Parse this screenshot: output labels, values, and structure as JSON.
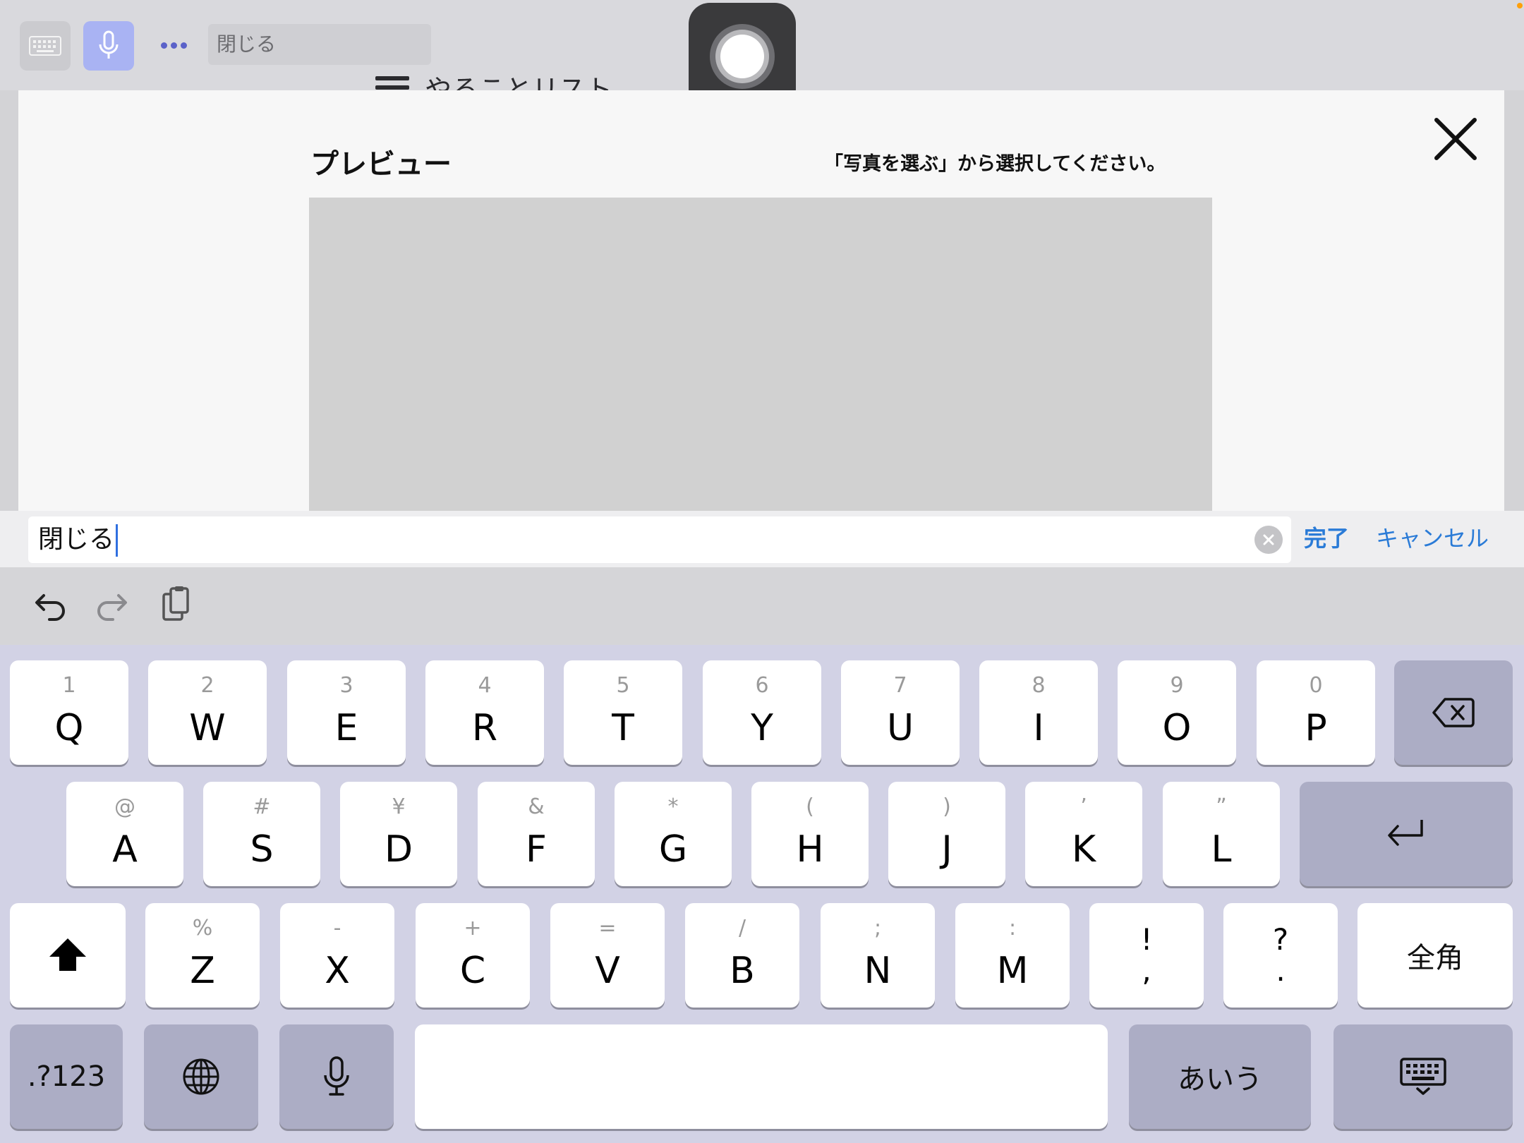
{
  "top_bar": {
    "field_text": "閉じる",
    "background_title": "やることリスト",
    "icons": [
      "keyboard-icon",
      "microphone-icon",
      "more-icon"
    ]
  },
  "modal": {
    "preview_label": "プレビュー",
    "hint": "「写真を選ぶ」から選択してください。",
    "close_icon": "close-icon"
  },
  "input": {
    "value": "閉じる",
    "done_label": "完了",
    "cancel_label": "キャンセル"
  },
  "keyboard": {
    "toolbar_icons": [
      "undo-icon",
      "redo-icon",
      "paste-icon"
    ],
    "row1": [
      {
        "sec": "1",
        "pri": "Q"
      },
      {
        "sec": "2",
        "pri": "W"
      },
      {
        "sec": "3",
        "pri": "E"
      },
      {
        "sec": "4",
        "pri": "R"
      },
      {
        "sec": "5",
        "pri": "T"
      },
      {
        "sec": "6",
        "pri": "Y"
      },
      {
        "sec": "7",
        "pri": "U"
      },
      {
        "sec": "8",
        "pri": "I"
      },
      {
        "sec": "9",
        "pri": "O"
      },
      {
        "sec": "0",
        "pri": "P"
      }
    ],
    "row2": [
      {
        "sec": "@",
        "pri": "A"
      },
      {
        "sec": "#",
        "pri": "S"
      },
      {
        "sec": "¥",
        "pri": "D"
      },
      {
        "sec": "&",
        "pri": "F"
      },
      {
        "sec": "*",
        "pri": "G"
      },
      {
        "sec": "(",
        "pri": "H"
      },
      {
        "sec": ")",
        "pri": "J"
      },
      {
        "sec": "’",
        "pri": "K"
      },
      {
        "sec": "”",
        "pri": "L"
      }
    ],
    "row3": [
      {
        "sec": "%",
        "pri": "Z"
      },
      {
        "sec": "-",
        "pri": "X"
      },
      {
        "sec": "+",
        "pri": "C"
      },
      {
        "sec": "=",
        "pri": "V"
      },
      {
        "sec": "/",
        "pri": "B"
      },
      {
        "sec": ";",
        "pri": "N"
      },
      {
        "sec": ":",
        "pri": "M"
      }
    ],
    "exclaim_key": {
      "top": "!",
      "bottom": ","
    },
    "question_key": {
      "top": "?",
      "bottom": "."
    },
    "zenkaku_label": "全角",
    "numbers_label": ".?123",
    "kana_label": "あいう",
    "space_label": ""
  }
}
